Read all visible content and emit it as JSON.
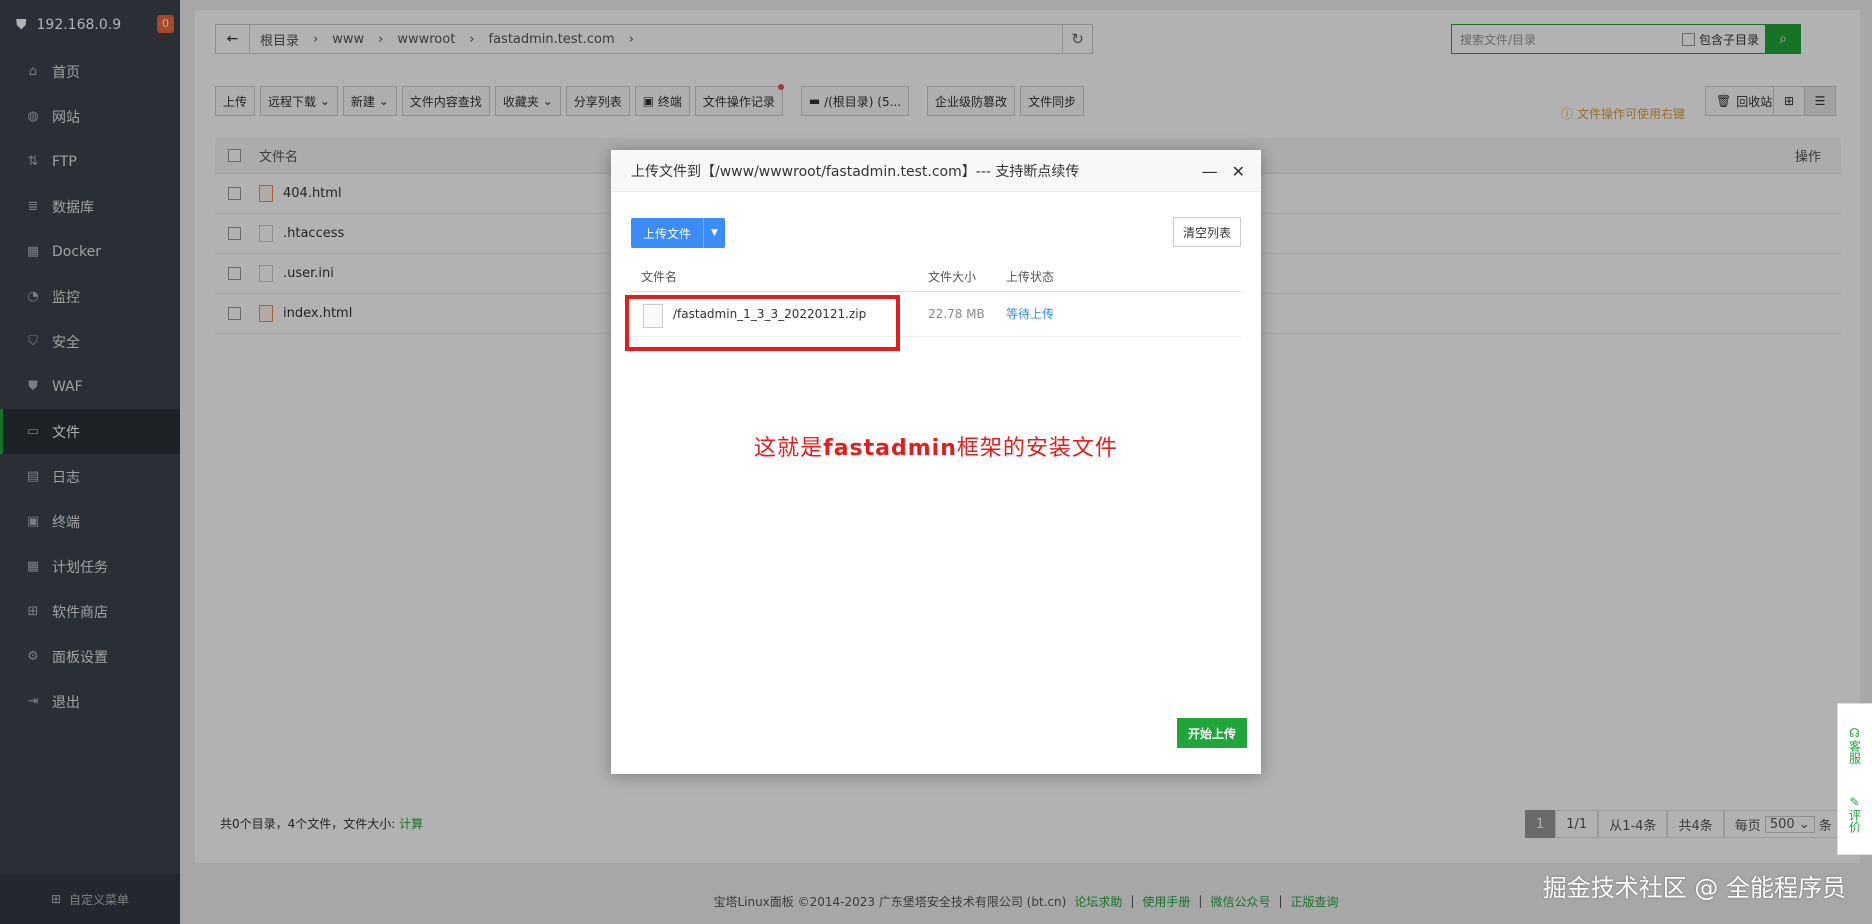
{
  "sidebar": {
    "host": "192.168.0.9",
    "badge": "0",
    "items": [
      {
        "label": "首页",
        "icon": "home-icon"
      },
      {
        "label": "网站",
        "icon": "globe-icon"
      },
      {
        "label": "FTP",
        "icon": "ftp-icon"
      },
      {
        "label": "数据库",
        "icon": "database-icon"
      },
      {
        "label": "Docker",
        "icon": "docker-icon"
      },
      {
        "label": "监控",
        "icon": "monitor-icon"
      },
      {
        "label": "安全",
        "icon": "shield-icon"
      },
      {
        "label": "WAF",
        "icon": "waf-icon"
      },
      {
        "label": "文件",
        "icon": "folder-icon"
      },
      {
        "label": "日志",
        "icon": "log-icon"
      },
      {
        "label": "终端",
        "icon": "terminal-icon"
      },
      {
        "label": "计划任务",
        "icon": "calendar-icon"
      },
      {
        "label": "软件商店",
        "icon": "grid-icon"
      },
      {
        "label": "面板设置",
        "icon": "gear-icon"
      },
      {
        "label": "退出",
        "icon": "logout-icon"
      }
    ],
    "active": "文件",
    "footer": "自定义菜单"
  },
  "path": {
    "crumbs": [
      "根目录",
      "www",
      "wwwroot",
      "fastadmin.test.com"
    ]
  },
  "search": {
    "placeholder": "搜索文件/目录",
    "include_sub": "包含子目录"
  },
  "toolbar": {
    "upload": "上传",
    "remote_download": "远程下载",
    "new": "新建",
    "content_search": "文件内容查找",
    "favorites": "收藏夹",
    "share_list": "分享列表",
    "terminal": "终端",
    "op_log": "文件操作记录",
    "disk": "/(根目录) (5...",
    "tamper": "企业级防篡改",
    "sync": "文件同步",
    "tip": "文件操作可使用右键",
    "recycle": "回收站"
  },
  "table": {
    "col_name": "文件名",
    "col_ops": "操作",
    "rows": [
      ".htaccess",
      ".user.ini",
      "index.html"
    ],
    "first_row": "404.html"
  },
  "summary": {
    "text": "共0个目录，4个文件，文件大小:",
    "calc": "计算"
  },
  "pager": {
    "page": "1",
    "pages": "1/1",
    "range": "从1-4条",
    "total": "共4条",
    "per_page_label": "每页",
    "per_page": "500",
    "unit": "条"
  },
  "footer": {
    "copyright": "宝塔Linux面板 ©2014-2023 广东堡塔安全技术有限公司 (bt.cn)",
    "links": [
      "论坛求助",
      "使用手册",
      "微信公众号",
      "正版查询"
    ]
  },
  "dialog": {
    "title": "上传文件到【/www/wwwroot/fastadmin.test.com】--- 支持断点续传",
    "upload_btn": "上传文件",
    "clear_btn": "清空列表",
    "cols": {
      "name": "文件名",
      "size": "文件大小",
      "status": "上传状态"
    },
    "file": {
      "name": "/fastadmin_1_3_3_20220121.zip",
      "size": "22.78 MB",
      "status": "等待上传"
    },
    "note_a": "这就是",
    "note_b": "fastadmin",
    "note_c": "框架的安装文件",
    "start_btn": "开始上传"
  },
  "side_service": {
    "service": "客服",
    "review": "评价"
  },
  "watermark": "掘金技术社区 @ 全能程序员",
  "colors": {
    "accent": "#20a53a",
    "primary": "#3b8cf6",
    "annotation": "#e21d1d"
  }
}
